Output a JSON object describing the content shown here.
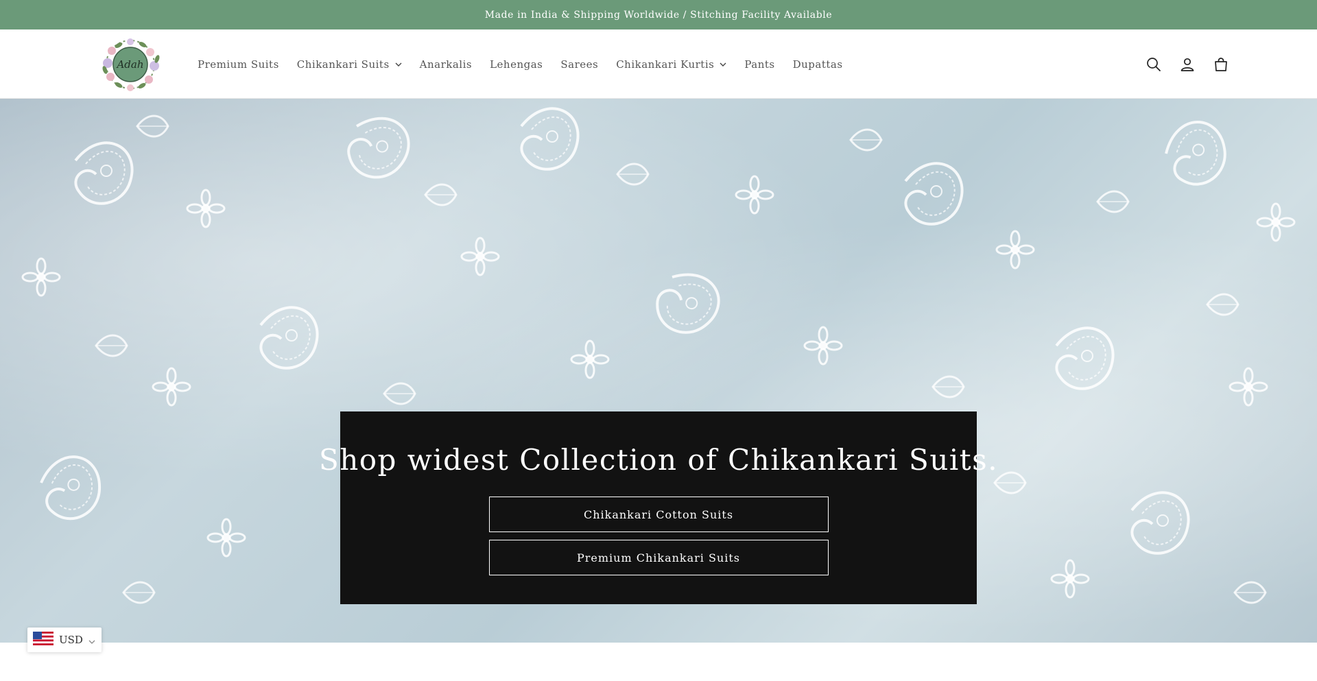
{
  "announcement": {
    "text": "Made in India & Shipping Worldwide / Stitching Facility Available"
  },
  "header": {
    "logo_text": "Adah",
    "nav": [
      {
        "label": "Premium Suits",
        "has_dropdown": false
      },
      {
        "label": "Chikankari Suits",
        "has_dropdown": true
      },
      {
        "label": "Anarkalis",
        "has_dropdown": false
      },
      {
        "label": "Lehengas",
        "has_dropdown": false
      },
      {
        "label": "Sarees",
        "has_dropdown": false
      },
      {
        "label": "Chikankari Kurtis",
        "has_dropdown": true
      },
      {
        "label": "Pants",
        "has_dropdown": false
      },
      {
        "label": "Dupattas",
        "has_dropdown": false
      }
    ],
    "icons": [
      "search-icon",
      "account-icon",
      "cart-icon"
    ]
  },
  "hero": {
    "title": "Shop widest Collection of Chikankari Suits.",
    "buttons": [
      "Chikankari Cotton Suits",
      "Premium Chikankari Suits"
    ]
  },
  "currency": {
    "code": "USD",
    "flag": "us-flag-icon"
  },
  "colors": {
    "announcement_bg": "#6b9a79",
    "hero_box_bg": "#121212",
    "logo_circle": "#6b9a79"
  }
}
